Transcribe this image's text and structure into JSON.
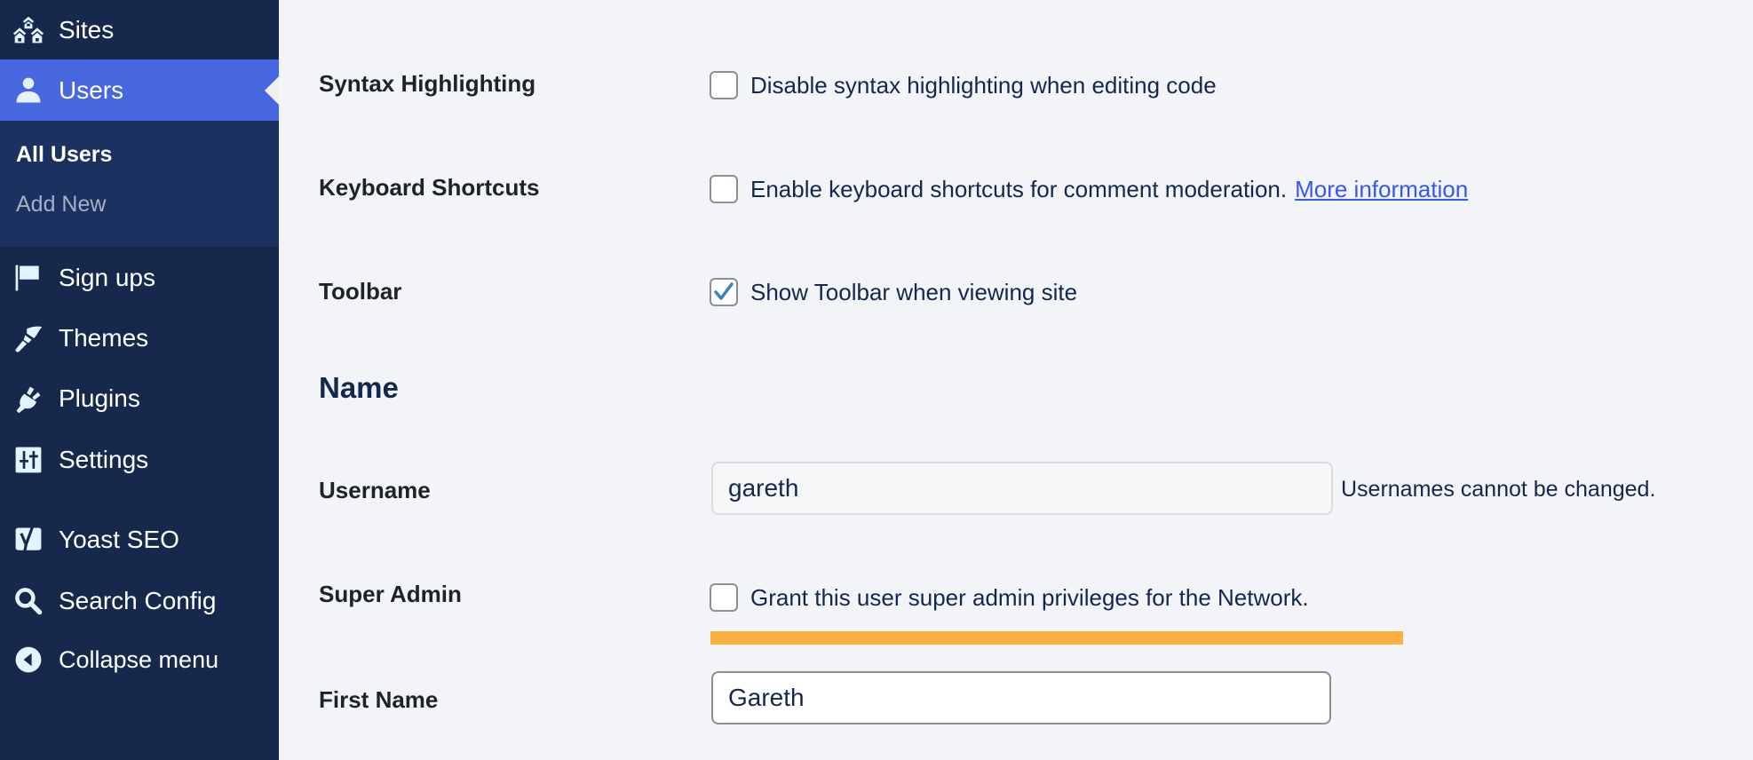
{
  "sidebar": {
    "items": [
      {
        "label": "Sites",
        "icon": "sites-icon"
      },
      {
        "label": "Users",
        "icon": "user-icon",
        "active": true
      },
      {
        "label": "Sign ups",
        "icon": "flag-icon"
      },
      {
        "label": "Themes",
        "icon": "paintbrush-icon"
      },
      {
        "label": "Plugins",
        "icon": "plug-icon"
      },
      {
        "label": "Settings",
        "icon": "sliders-icon"
      },
      {
        "label": "Yoast SEO",
        "icon": "yoast-icon"
      },
      {
        "label": "Search Config",
        "icon": "search-icon"
      },
      {
        "label": "Collapse menu",
        "icon": "collapse-arrow-icon"
      }
    ],
    "submenu": [
      {
        "label": "All Users",
        "current": true
      },
      {
        "label": "Add New",
        "current": false
      }
    ]
  },
  "main": {
    "syntax_highlighting": {
      "label": "Syntax Highlighting",
      "option": "Disable syntax highlighting when editing code",
      "checked": false
    },
    "keyboard_shortcuts": {
      "label": "Keyboard Shortcuts",
      "option": "Enable keyboard shortcuts for comment moderation.",
      "link": "More information",
      "checked": false
    },
    "toolbar": {
      "label": "Toolbar",
      "option": "Show Toolbar when viewing site",
      "checked": true
    },
    "name_section": {
      "heading": "Name"
    },
    "username": {
      "label": "Username",
      "value": "gareth",
      "description": "Usernames cannot be changed."
    },
    "super_admin": {
      "label": "Super Admin",
      "option": "Grant this user super admin privileges for the Network.",
      "checked": false
    },
    "first_name": {
      "label": "First Name",
      "value": "Gareth"
    }
  },
  "colors": {
    "sidebar_bg": "#16294d",
    "active_item": "#4667e0",
    "link": "#3858e9",
    "highlight_bar": "#fbb040",
    "checkmark": "#3582c4"
  }
}
